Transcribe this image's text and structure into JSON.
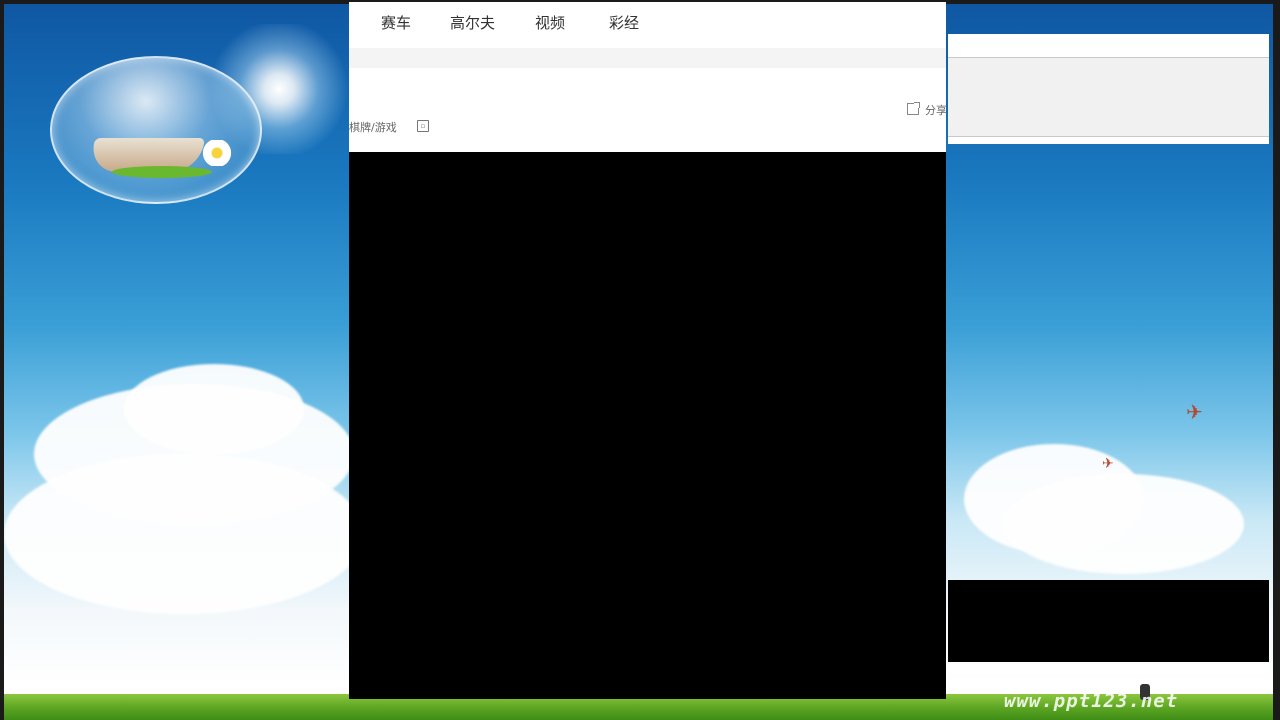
{
  "nav": {
    "items": [
      {
        "label": "赛车"
      },
      {
        "label": "高尔夫"
      },
      {
        "label": "视频"
      },
      {
        "label": "彩经"
      }
    ]
  },
  "toolbar": {
    "share_label": "分享"
  },
  "breadcrumb": {
    "label": "棋牌/游戏"
  },
  "background": {
    "watermark": "www.ppt123.net"
  },
  "colors": {
    "video_bg": "#000000",
    "sky_top": "#0f57a3",
    "grass": "#5fa724"
  },
  "icons": {
    "share": "external-link-icon",
    "breadcrumb": "small-square-icon"
  }
}
